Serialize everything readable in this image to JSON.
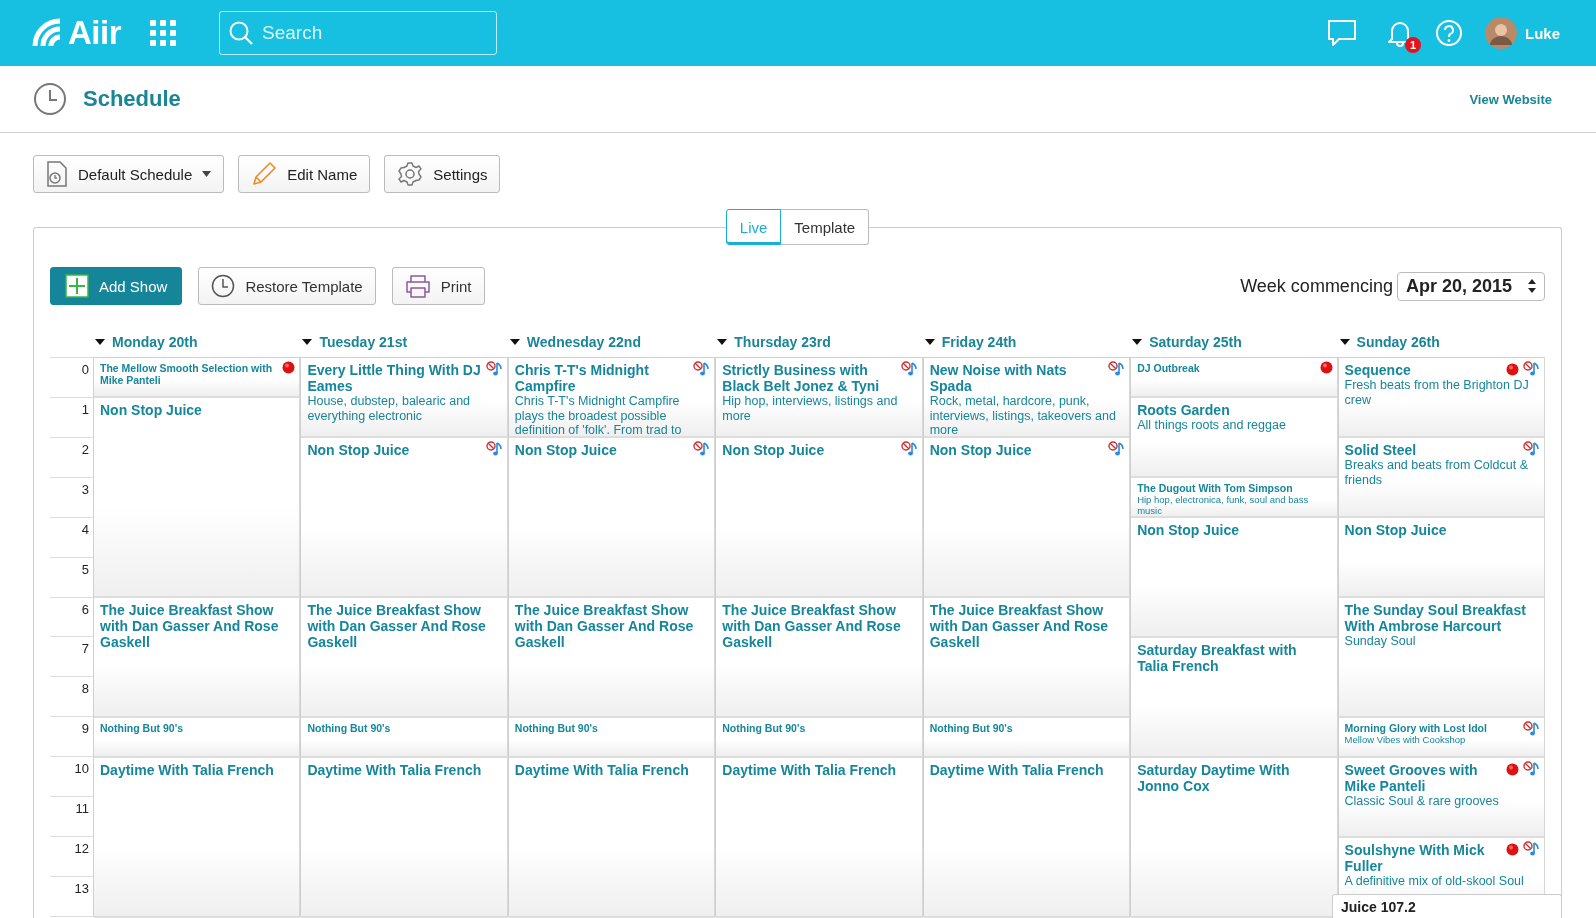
{
  "top_bar": {
    "logo": "Aiir",
    "search": {
      "placeholder": "Search"
    },
    "notifications": "1",
    "user": "Luke"
  },
  "page": {
    "title": "Schedule",
    "link": "View Website"
  },
  "toolbar": [
    {
      "label": "Default Schedule",
      "kind": "dropdown"
    },
    {
      "label": "Edit Name",
      "kind": "edit"
    },
    {
      "label": "Settings",
      "kind": "settings"
    }
  ],
  "tabs": [
    {
      "label": "Live",
      "selected": true
    },
    {
      "label": "Template",
      "selected": false
    }
  ],
  "actions": [
    {
      "label": "Add Show",
      "kind": "add"
    },
    {
      "label": "Restore Template",
      "kind": "restore"
    },
    {
      "label": "Print",
      "kind": "print"
    }
  ],
  "week": {
    "label": "Week commencing",
    "value": "Apr 20, 2015"
  },
  "hours": [
    "0",
    "1",
    "2",
    "3",
    "4",
    "5",
    "6",
    "7",
    "8",
    "9",
    "10",
    "11",
    "12",
    "13"
  ],
  "days": [
    {
      "label": "Monday 20th",
      "expanded": true,
      "shows": [
        {
          "title": "The Mellow Smooth Selection with Mike Panteli",
          "kind": "one",
          "recording": true,
          "no_music": false
        },
        {
          "title": "Non Stop Juice",
          "kind": "five",
          "recording": false,
          "no_music": false
        },
        {
          "title": "The Juice Breakfast Show with Dan Gasser And Rose Gaskell",
          "kind": "three",
          "recording": false,
          "no_music": false
        },
        {
          "title": "Nothing But 90's",
          "kind": "one",
          "recording": false,
          "no_music": false
        },
        {
          "title": "Daytime With Talia French",
          "kind": "four",
          "recording": false,
          "no_music": false
        }
      ]
    },
    {
      "label": "Tuesday 21st",
      "expanded": true,
      "shows": [
        {
          "title": "Every Little Thing With DJ Eames",
          "description": "House, dubstep, balearic and everything electronic",
          "kind": "two",
          "recording": false,
          "no_music": true
        },
        {
          "title": "Non Stop Juice",
          "kind": "four",
          "recording": false,
          "no_music": true
        },
        {
          "title": "The Juice Breakfast Show with Dan Gasser And Rose Gaskell",
          "kind": "three",
          "recording": false,
          "no_music": false
        },
        {
          "title": "Nothing But 90's",
          "kind": "one",
          "recording": false,
          "no_music": false
        },
        {
          "title": "Daytime With Talia French",
          "kind": "four",
          "recording": false,
          "no_music": false
        }
      ]
    },
    {
      "label": "Wednesday 22nd",
      "expanded": true,
      "shows": [
        {
          "title": "Chris T-T's Midnight Campfire",
          "description": "Chris T-T's Midnight Campfire plays the broadest possible definition of 'folk'. From trad to",
          "kind": "two",
          "recording": false,
          "no_music": true
        },
        {
          "title": "Non Stop Juice",
          "kind": "four",
          "recording": false,
          "no_music": true
        },
        {
          "title": "The Juice Breakfast Show with Dan Gasser And Rose Gaskell",
          "kind": "three",
          "recording": false,
          "no_music": false
        },
        {
          "title": "Nothing But 90's",
          "kind": "one",
          "recording": false,
          "no_music": false
        },
        {
          "title": "Daytime With Talia French",
          "kind": "four",
          "recording": false,
          "no_music": false
        }
      ]
    },
    {
      "label": "Thursday 23rd",
      "expanded": true,
      "shows": [
        {
          "title": "Strictly Business with Black Belt Jonez & Tyni",
          "description": "Hip hop, interviews, listings and more",
          "kind": "two",
          "recording": false,
          "no_music": true
        },
        {
          "title": "Non Stop Juice",
          "kind": "four",
          "recording": false,
          "no_music": true
        },
        {
          "title": "The Juice Breakfast Show with Dan Gasser And Rose Gaskell",
          "kind": "three",
          "recording": false,
          "no_music": false
        },
        {
          "title": "Nothing But 90's",
          "kind": "one",
          "recording": false,
          "no_music": false
        },
        {
          "title": "Daytime With Talia French",
          "kind": "four",
          "recording": false,
          "no_music": false
        }
      ]
    },
    {
      "label": "Friday 24th",
      "expanded": true,
      "shows": [
        {
          "title": "New Noise with Nats Spada",
          "description": "Rock, metal, hardcore, punk, interviews, listings, takeovers and more",
          "kind": "two",
          "recording": false,
          "no_music": true
        },
        {
          "title": "Non Stop Juice",
          "kind": "four",
          "recording": false,
          "no_music": true
        },
        {
          "title": "The Juice Breakfast Show with Dan Gasser And Rose Gaskell",
          "kind": "three",
          "recording": false,
          "no_music": false
        },
        {
          "title": "Nothing But 90's",
          "kind": "one",
          "recording": false,
          "no_music": false
        },
        {
          "title": "Daytime With Talia French",
          "kind": "four",
          "recording": false,
          "no_music": false
        }
      ]
    },
    {
      "label": "Saturday 25th",
      "expanded": true,
      "shows": [
        {
          "title": "DJ Outbreak",
          "kind": "one",
          "recording": true,
          "no_music": false
        },
        {
          "title": "Roots Garden",
          "description": "All things roots and reggae",
          "kind": "two",
          "recording": false,
          "no_music": false
        },
        {
          "title": "The Dugout With Tom Simpson",
          "description": "Hip hop, electronica, funk, soul and bass music",
          "kind": "one",
          "recording": false,
          "no_music": false
        },
        {
          "title": "Non Stop Juice",
          "kind": "three",
          "recording": false,
          "no_music": false
        },
        {
          "title": "Saturday Breakfast with Talia French",
          "kind": "three",
          "recording": false,
          "no_music": false
        },
        {
          "title": "Saturday Daytime With Jonno Cox",
          "kind": "four",
          "recording": false,
          "no_music": false
        }
      ]
    },
    {
      "label": "Sunday 26th",
      "expanded": true,
      "shows": [
        {
          "title": "Sequence",
          "description": "Fresh beats from the Brighton DJ crew",
          "kind": "two",
          "recording": true,
          "no_music": true
        },
        {
          "title": "Solid Steel",
          "description": "Breaks and beats from Coldcut & friends",
          "kind": "two",
          "recording": false,
          "no_music": true
        },
        {
          "title": "Non Stop Juice",
          "kind": "two",
          "recording": false,
          "no_music": false
        },
        {
          "title": "The Sunday Soul Breakfast With Ambrose Harcourt",
          "description": "Sunday Soul",
          "kind": "three",
          "recording": false,
          "no_music": false
        },
        {
          "title": "Morning Glory with Lost Idol",
          "description": "Mellow Vibes with Cookshop",
          "kind": "one",
          "recording": false,
          "no_music": true
        },
        {
          "title": "Sweet Grooves with Mike Panteli",
          "description": "Classic Soul & rare grooves",
          "kind": "two",
          "recording": true,
          "no_music": true
        },
        {
          "title": "Soulshyne With Mick Fuller",
          "description": "A definitive mix of old-skool Soul",
          "kind": "two",
          "recording": true,
          "no_music": true
        }
      ]
    }
  ],
  "player": {
    "title": "Juice 107.2"
  }
}
